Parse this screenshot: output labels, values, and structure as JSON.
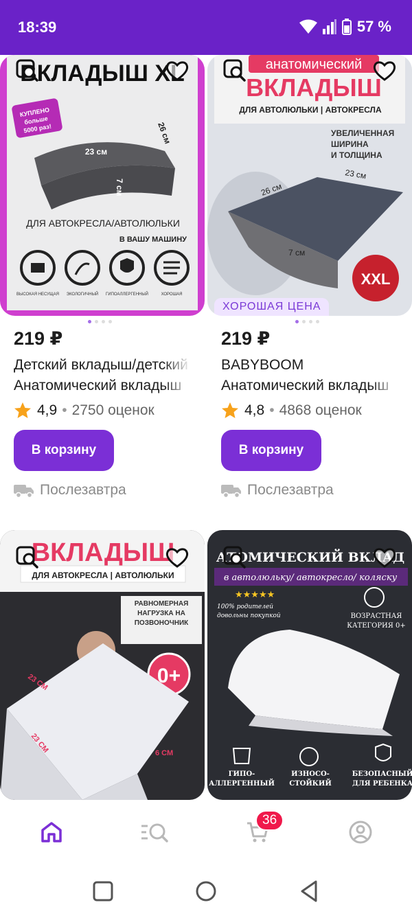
{
  "status_bar": {
    "time": "18:39",
    "battery": "57 %"
  },
  "products": [
    {
      "price": "219 ₽",
      "title": "Детский вкладыш/детский",
      "subtitle": "Анатомический вкладыш",
      "rating": "4,9",
      "reviews": "2750 оценок",
      "cart_label": "В корзину",
      "delivery": "Послезавтра",
      "image_text": {
        "headline": "ВКЛАДЫШ XL",
        "sticker": "КУПЛЕНО больше 5000 раз!",
        "dim_width": "23 см",
        "dim_depth": "26 см",
        "dim_height": "7 см",
        "caption": "ДЛЯ АВТОКРЕСЛА/АВТОЛЮЛЬКИ",
        "caption2": "В ВАШУ МАШИНУ",
        "features": [
          "ВЫСОКАЯ НЕСУЩАЯ СПОСОБНОСТЬ",
          "ЭКОЛОГИЧНЫЙ МАТЕРИАЛ",
          "ГИПОАЛЛЕРГЕННЫЙ НАПОЛНИТЕЛЬ",
          "ХОРОШАЯ ВОЗДУХОПРОНИЦАЕМОСТЬ"
        ]
      }
    },
    {
      "price": "219 ₽",
      "title": "BABYBOOM",
      "subtitle": "Анатомический вкладыш",
      "rating": "4,8",
      "reviews": "4868 оценок",
      "cart_label": "В корзину",
      "delivery": "Послезавтра",
      "badge": "ХОРОШАЯ ЦЕНА",
      "image_text": {
        "headline_top": "анатомический",
        "headline": "ВКЛАДЫШ",
        "caption": "ДЛЯ АВТОЛЮЛЬКИ | АВТОКРЕСЛА",
        "note": "УВЕЛИЧЕННАЯ ШИРИНА И ТОЛЩИНА",
        "dim_width": "23 см",
        "dim_depth": "26 см",
        "dim_height": "7 см",
        "size_badge": "XXL"
      }
    },
    {
      "image_text": {
        "headline": "ВКЛАДЫШ",
        "caption": "ДЛЯ АВТОКРЕСЛА | АВТОЛЮЛЬКИ",
        "note": "РАВНОМЕРНАЯ НАГРУЗКА НА ПОЗВОНОЧНИК",
        "age": "0+",
        "dim_depth": "23 СМ",
        "dim_width": "23 СМ",
        "dim_height": "6 СМ"
      }
    },
    {
      "image_text": {
        "headline": "АТОМИЧЕСКИЙ ВКЛАД",
        "caption": "в автолюльку/ автокресло/ коляску",
        "stars": "★★★★★",
        "note": "100% родителей довольны покупкой",
        "age": "ВОЗРАСТНАЯ КАТЕГОРИЯ 0+",
        "features": [
          "ГИПО- АЛЛЕРГЕННЫЙ",
          "ИЗНОСО- СТОЙКИЙ",
          "БЕЗОПАСНЫЙ ДЛЯ РЕБЕНКА"
        ]
      }
    }
  ],
  "bottom_nav": {
    "cart_count": "36"
  },
  "colors": {
    "accent": "#7b2fd6",
    "status_bar": "#6a22c8",
    "badge_red": "#f0194b",
    "star": "#f7a21b"
  }
}
